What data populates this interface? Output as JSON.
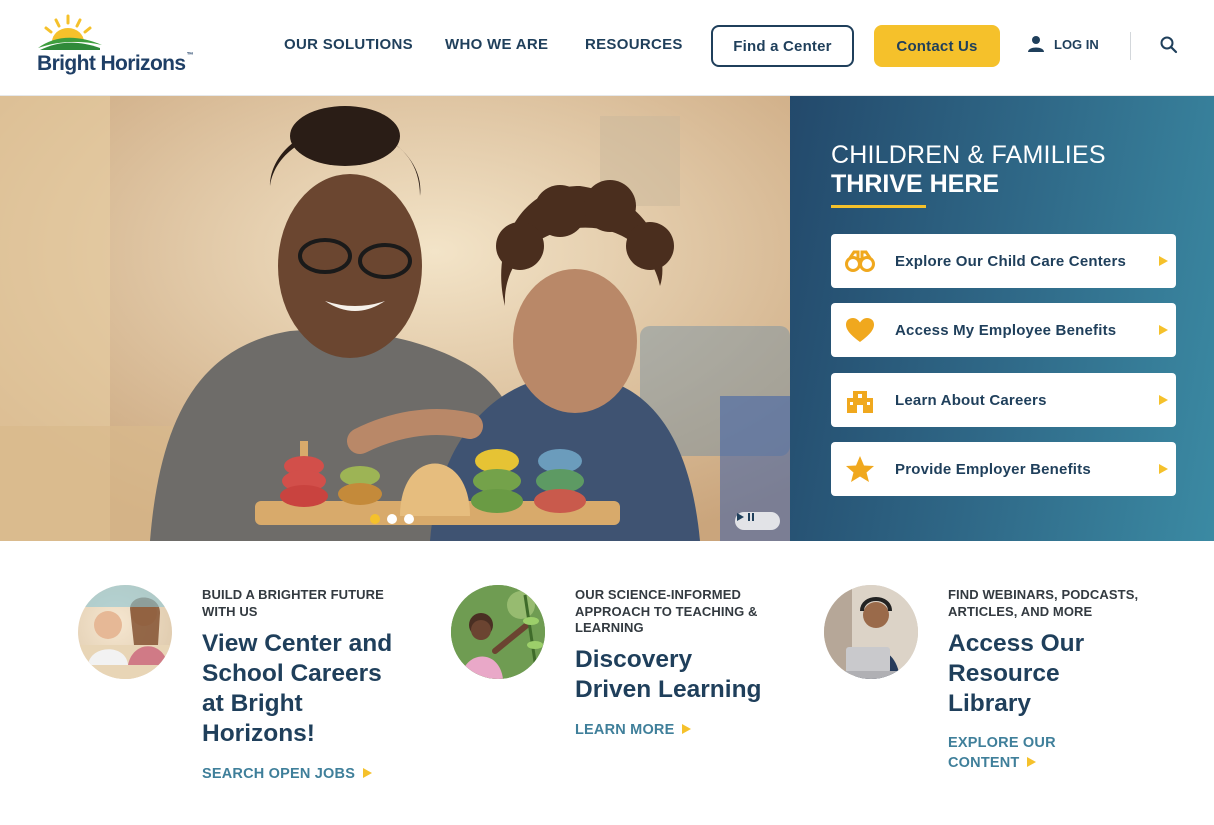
{
  "brand": {
    "name": "Bright Horizons",
    "trademark": "™",
    "logo_icon": "sunrise-icon",
    "colors": {
      "navy": "#1f3f5b",
      "yellow": "#f5c12b",
      "teal": "#3f7f9a"
    }
  },
  "nav": {
    "items": [
      "OUR SOLUTIONS",
      "WHO WE ARE",
      "RESOURCES"
    ],
    "find_center": "Find a Center",
    "contact": "Contact Us",
    "login": "LOG IN",
    "login_icon": "user-icon",
    "search_icon": "search-icon"
  },
  "hero": {
    "slides": 3,
    "active_slide": 1,
    "carousel_control_icon": "play-pause-icon",
    "panel": {
      "heading_line1": "CHILDREN & FAMILIES",
      "heading_line2": "THRIVE HERE",
      "links": [
        {
          "label": "Explore Our Child Care Centers",
          "icon": "binoculars-icon"
        },
        {
          "label": "Access My Employee Benefits",
          "icon": "heart-icon"
        },
        {
          "label": "Learn About Careers",
          "icon": "building-icon"
        },
        {
          "label": "Provide Employer Benefits",
          "icon": "star-icon"
        }
      ]
    }
  },
  "features": [
    {
      "eyebrow": "BUILD A BRIGHTER FUTURE WITH US",
      "title": "View Center and School Careers at Bright Horizons!",
      "link": "SEARCH OPEN JOBS"
    },
    {
      "eyebrow": "OUR SCIENCE-INFORMED APPROACH TO TEACHING & LEARNING",
      "title": "Discovery Driven Learning",
      "link": "LEARN MORE"
    },
    {
      "eyebrow": "FIND WEBINARS, PODCASTS, ARTICLES, AND MORE",
      "title": "Access Our Resource Library",
      "link": "EXPLORE OUR CONTENT"
    }
  ]
}
